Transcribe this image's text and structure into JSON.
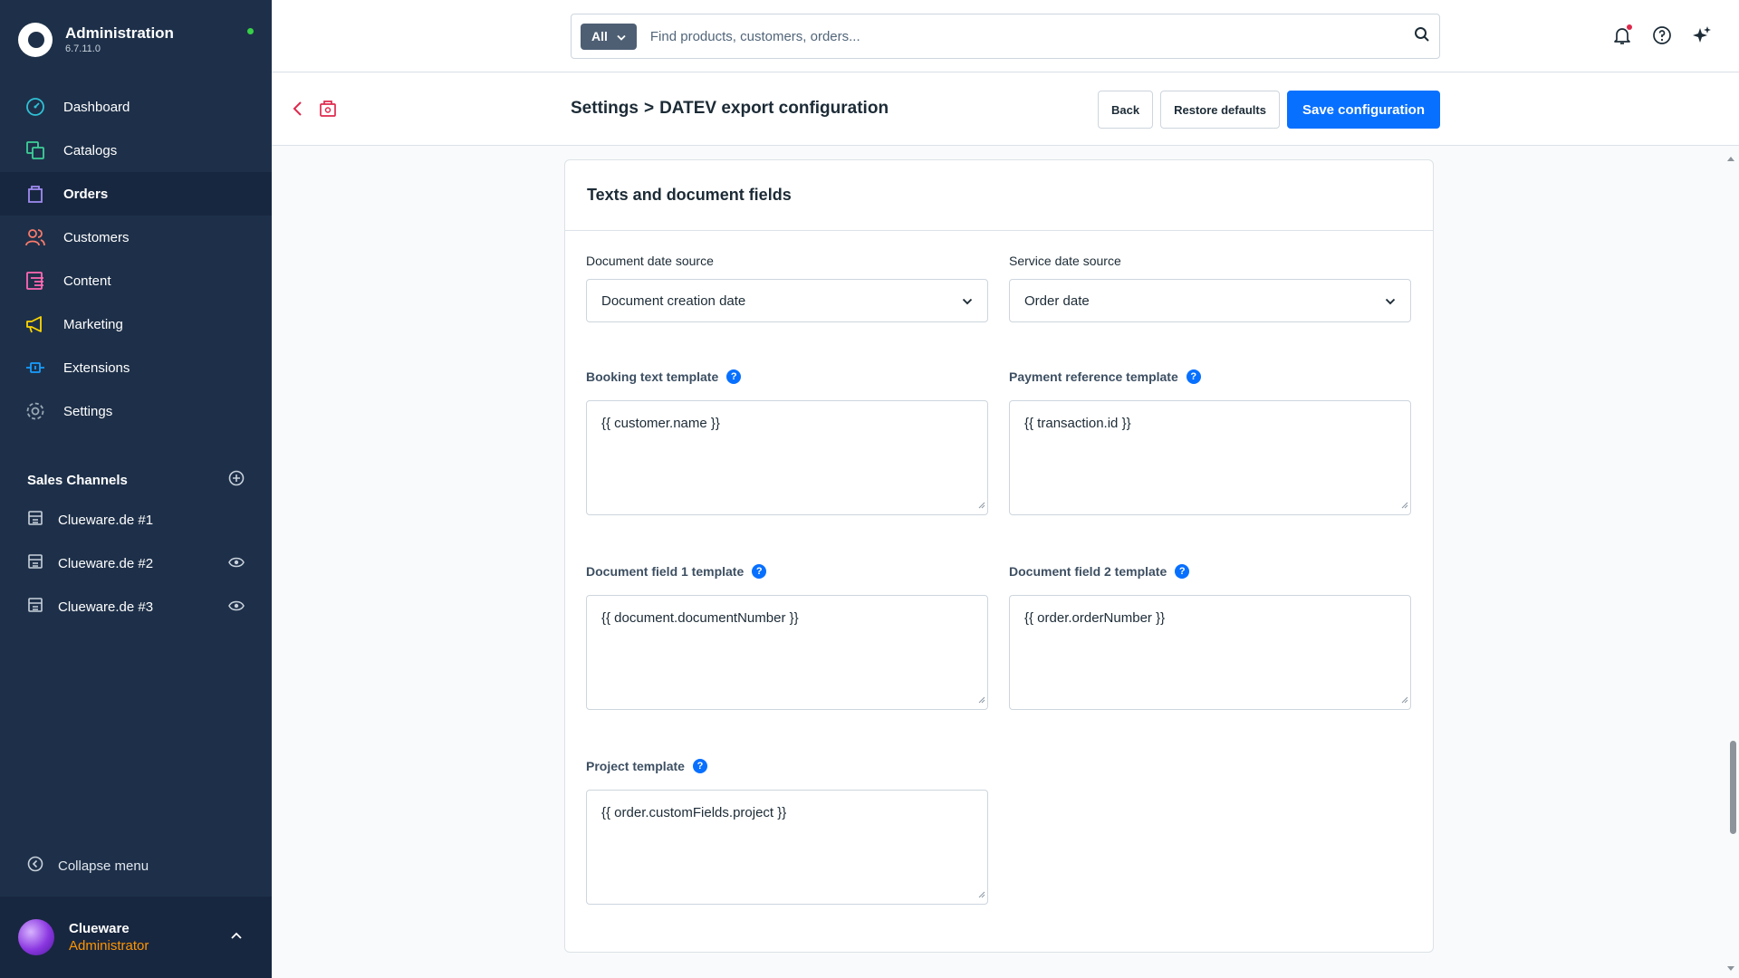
{
  "brand": {
    "title": "Administration",
    "version": "6.7.11.0"
  },
  "nav": [
    {
      "label": "Dashboard",
      "icon": "dashboard-icon"
    },
    {
      "label": "Catalogs",
      "icon": "catalogs-icon"
    },
    {
      "label": "Orders",
      "icon": "orders-icon",
      "active": true
    },
    {
      "label": "Customers",
      "icon": "customers-icon"
    },
    {
      "label": "Content",
      "icon": "content-icon"
    },
    {
      "label": "Marketing",
      "icon": "marketing-icon"
    },
    {
      "label": "Extensions",
      "icon": "extensions-icon"
    },
    {
      "label": "Settings",
      "icon": "settings-icon"
    }
  ],
  "sales_channels": {
    "header": "Sales Channels",
    "items": [
      {
        "label": "Clueware.de #1"
      },
      {
        "label": "Clueware.de #2"
      },
      {
        "label": "Clueware.de #3"
      }
    ]
  },
  "collapse_label": "Collapse menu",
  "user": {
    "name": "Clueware",
    "role": "Administrator"
  },
  "search": {
    "scope": "All",
    "placeholder": "Find products, customers, orders..."
  },
  "header": {
    "breadcrumb_parent": "Settings",
    "breadcrumb_sep": ">",
    "title": "DATEV export configuration",
    "back_label": "Back",
    "restore_label": "Restore defaults",
    "save_label": "Save configuration"
  },
  "card": {
    "title": "Texts and document fields",
    "document_date_source": {
      "label": "Document date source",
      "value": "Document creation date"
    },
    "service_date_source": {
      "label": "Service date source",
      "value": "Order date"
    },
    "booking_text_template": {
      "label": "Booking text template",
      "value": "{{ customer.name }}"
    },
    "payment_reference_template": {
      "label": "Payment reference template",
      "value": "{{ transaction.id }}"
    },
    "document_field_1_template": {
      "label": "Document field 1 template",
      "value": "{{ document.documentNumber }}"
    },
    "document_field_2_template": {
      "label": "Document field 2 template",
      "value": "{{ order.orderNumber }}"
    },
    "project_template": {
      "label": "Project template",
      "value": "{{ order.customFields.project }}"
    },
    "help_glyph": "?"
  },
  "colors": {
    "sidebar_bg": "#1e3049",
    "sidebar_active_bg": "#182740",
    "primary": "#0870ff",
    "status_online": "#37d046",
    "user_role": "#ff9500"
  }
}
